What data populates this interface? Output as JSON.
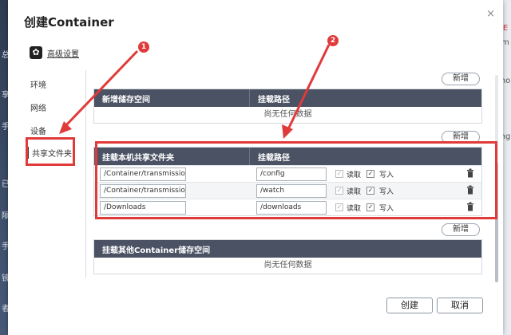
{
  "dialog": {
    "title": "创建Container",
    "close_icon": "×",
    "advanced_settings_label": "高级设置"
  },
  "nav": {
    "items": [
      "环境",
      "网络",
      "设备",
      "共享文件夹"
    ],
    "active": "共享文件夹"
  },
  "volumes": {
    "add_label": "新增",
    "col_storage": "新增储存空间",
    "col_mount": "挂载路径",
    "empty_text": "尚无任何数据"
  },
  "shared_folders": {
    "add_label": "新增",
    "col_host": "挂载本机共享文件夹",
    "col_mount": "挂载路径",
    "read_label": "读取",
    "write_label": "写入",
    "rows": [
      {
        "host": "/Container/transmission",
        "mount": "/config"
      },
      {
        "host": "/Container/transmission/",
        "mount": "/watch"
      },
      {
        "host": "/Downloads",
        "mount": "/downloads"
      }
    ]
  },
  "other_containers": {
    "add_label": "新增",
    "col": "挂载其他Container储存空间",
    "empty_text": "尚无任何数据"
  },
  "footer": {
    "create_label": "创建",
    "cancel_label": "取消"
  },
  "annotations": {
    "badge1": "1",
    "badge2": "2"
  },
  "colors": {
    "highlight": "#e03a3a",
    "table_header": "#4a5264"
  },
  "background": {
    "left_glyphs": [
      "总",
      "享",
      "手",
      "已",
      "隔",
      "手",
      "镜",
      "者"
    ],
    "right_glyphs": [
      "E",
      "m",
      "ho",
      "ng"
    ]
  }
}
